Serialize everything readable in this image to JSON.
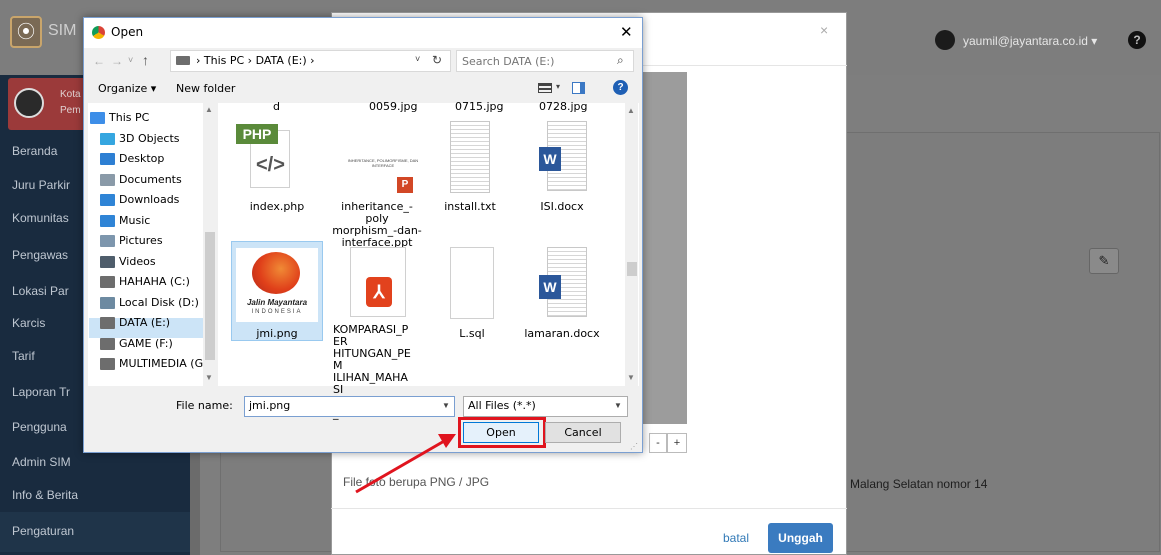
{
  "app": {
    "brand": "SIM",
    "user_email": "yaumil@jayantara.co.id ▾",
    "help": "?",
    "org_name": "Kota\nPem"
  },
  "sidebar": {
    "items": [
      {
        "label": "Beranda"
      },
      {
        "label": "Juru Parkir"
      },
      {
        "label": "Komunitas"
      },
      {
        "label": "Pengawas"
      },
      {
        "label": "Lokasi Par"
      },
      {
        "label": "Karcis"
      },
      {
        "label": "Tarif"
      },
      {
        "label": "Laporan Tr"
      },
      {
        "label": "Pengguna"
      },
      {
        "label": "Admin SIM"
      },
      {
        "label": "Info & Berita"
      },
      {
        "label": "Pengaturan"
      }
    ]
  },
  "content": {
    "address_fragment": "Malang Selatan nomor 14"
  },
  "modal": {
    "close": "×",
    "zoom_out": "-",
    "zoom_in": "+",
    "hint": "File foto berupa PNG / JPG",
    "cancel_label": "batal",
    "upload_label": "Unggah"
  },
  "dialog": {
    "title": "Open",
    "close": "✕",
    "nav": {
      "back": "←",
      "forward": "→",
      "recent": "˅",
      "up": "↑",
      "dropdown": "˅",
      "refresh": "↻"
    },
    "address_path": "›  This PC  ›  DATA (E:)  ›",
    "search_placeholder": "Search DATA (E:)",
    "search_icon": "⌕",
    "toolbar": {
      "organize": "Organize ▾",
      "new_folder": "New folder",
      "view_dd": "▾",
      "help": "?"
    },
    "nav_pane": [
      {
        "label": "This PC",
        "icon": "monitor-icon",
        "color": "#3d8ee8"
      },
      {
        "label": "3D Objects",
        "icon": "cube-icon",
        "color": "#35a6e0"
      },
      {
        "label": "Desktop",
        "icon": "desktop-icon",
        "color": "#2d7fd3"
      },
      {
        "label": "Documents",
        "icon": "documents-icon",
        "color": "#8a9aa8"
      },
      {
        "label": "Downloads",
        "icon": "downloads-icon",
        "color": "#2f84d6"
      },
      {
        "label": "Music",
        "icon": "music-icon",
        "color": "#2f84d6"
      },
      {
        "label": "Pictures",
        "icon": "pictures-icon",
        "color": "#7d96ad"
      },
      {
        "label": "Videos",
        "icon": "videos-icon",
        "color": "#4f5d6b"
      },
      {
        "label": "HAHAHA (C:)",
        "icon": "drive-icon",
        "color": "#6d6d6d"
      },
      {
        "label": "Local Disk (D:)",
        "icon": "drive-icon",
        "color": "#6d8aa1"
      },
      {
        "label": "DATA (E:)",
        "icon": "drive-icon",
        "color": "#6d6d6d"
      },
      {
        "label": "GAME (F:)",
        "icon": "drive-icon",
        "color": "#6d6d6d"
      },
      {
        "label": "MULTIMEDIA (G",
        "icon": "drive-icon",
        "color": "#6d6d6d"
      }
    ],
    "top_captions": [
      "d",
      "0059.jpg",
      "0715.jpg",
      "0728.jpg"
    ],
    "files": [
      {
        "name": "index.php",
        "icon": "php-file-icon"
      },
      {
        "name": "inheritance_-poly morphism_-dan-interface.ppt",
        "icon": "ppt-file-icon",
        "thumb_text": "INHERITANCE, POLIMORFISME, DAN INTERFACE"
      },
      {
        "name": "install.txt",
        "icon": "txt-file-icon"
      },
      {
        "name": "ISI.docx",
        "icon": "word-file-icon"
      },
      {
        "name": "jmi.png",
        "icon": "image-file-icon",
        "thumb_text": "Jalin Mayantara",
        "thumb_sub": "INDONESIA"
      },
      {
        "name": "KOMPARASI_PER HITUNGAN_PEM ILIHAN_MAHASI SWA_TERBAIK_...",
        "icon": "pdf-file-icon"
      },
      {
        "name": "L.sql",
        "icon": "sql-file-icon"
      },
      {
        "name": "lamaran.docx",
        "icon": "word-file-icon"
      }
    ],
    "php_badge": "PHP",
    "php_glyph": "</>",
    "ppt_badge": "P",
    "word_badge": "W",
    "file_name_label": "File name:",
    "file_name_value": "jmi.png",
    "filter_value": "All Files (*.*)",
    "open_label": "Open",
    "cancel_label": "Cancel"
  },
  "colors": {
    "highlight_red": "#e0141e",
    "accent_blue": "#3a7bc0"
  }
}
